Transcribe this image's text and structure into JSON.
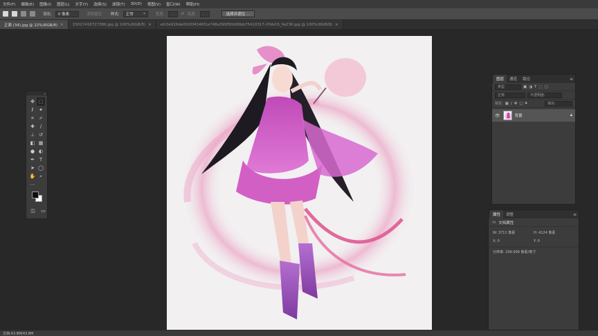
{
  "menu": [
    "文件(F)",
    "编辑(E)",
    "图像(I)",
    "图层(L)",
    "文字(Y)",
    "选择(S)",
    "滤镜(T)",
    "3D(D)",
    "视图(V)",
    "窗口(W)",
    "帮助(H)"
  ],
  "options": {
    "feather_label": "羽化:",
    "feather_value": "0 像素",
    "antialias_label": "消除锯齿",
    "style_label": "样式:",
    "style_value": "正常",
    "width_label": "宽度:",
    "height_label": "高度:",
    "select_mask_button": "选择并遮住 ..."
  },
  "tabs": [
    {
      "label": "正面 (34).jpg @ 22%(RGB/8)",
      "active": true
    },
    {
      "label": "150174187273​86.jpg @ 100%(RGB/8)",
      "active": false
    },
    {
      "label": "efc0e919de0020f4346f1e748a399f50b96bb7541031​7-OlVe​C6_fw236.jpg @ 100%(RGB/8)",
      "active": false
    }
  ],
  "layers_panel": {
    "tabs": [
      "图层",
      "通道",
      "路径"
    ],
    "kind_filter": "类型",
    "blend_mode": "正常",
    "opacity_label": "不透明度:",
    "lock_label": "锁定:",
    "fill_label": "填充:",
    "layer": {
      "name": "背景"
    }
  },
  "properties_panel": {
    "tabs": [
      "属性",
      "调整"
    ],
    "section_title": "文档属性",
    "w_label": "W:",
    "w_value": "3711 像素",
    "h_label": "H:",
    "h_value": "4124 像素",
    "x_label": "X:",
    "x_value": "0",
    "y_label": "Y:",
    "y_value": "0",
    "resolution": "分辨率: 299.999 像素/英寸"
  },
  "status": {
    "doc_size": "文档:43.8M/43.8M"
  },
  "colors": {
    "accent": "#d86aa0",
    "foreground": "#0e0e0e",
    "background": "#ffffff"
  },
  "tools": [
    "move-icon",
    "marquee-icon",
    "lasso-icon",
    "magic-wand-icon",
    "crop-icon",
    "eyedropper-icon",
    "healing-brush-icon",
    "brush-icon",
    "clone-stamp-icon",
    "history-brush-icon",
    "eraser-icon",
    "gradient-icon",
    "blur-icon",
    "dodge-icon",
    "pen-icon",
    "type-icon",
    "path-select-icon",
    "shape-icon",
    "hand-icon",
    "zoom-icon"
  ]
}
